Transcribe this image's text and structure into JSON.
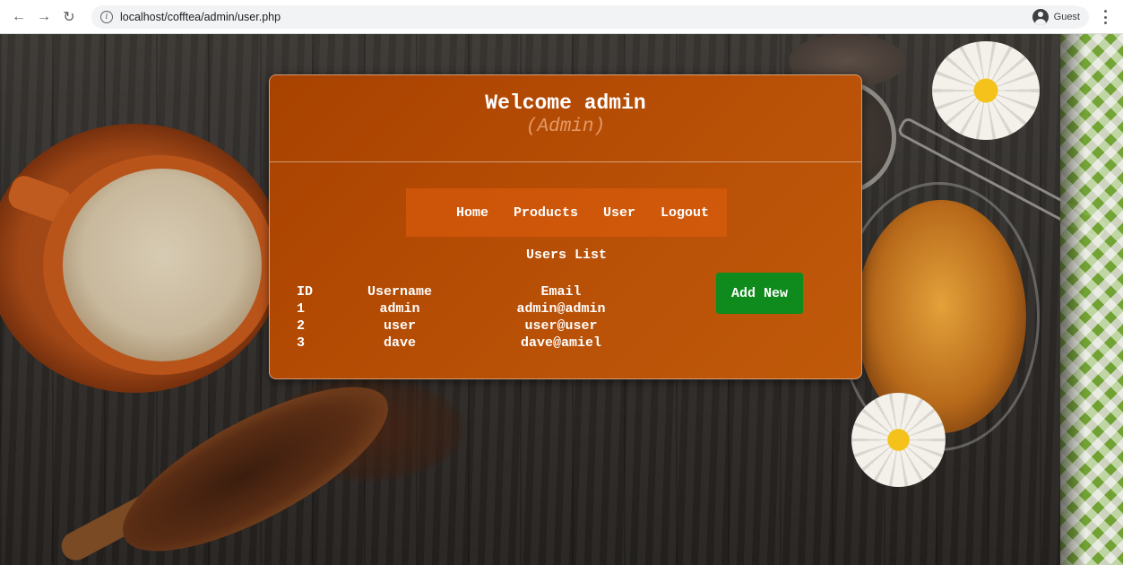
{
  "browser": {
    "url": "localhost/cofftea/admin/user.php",
    "profile_label": "Guest"
  },
  "header": {
    "welcome": "Welcome admin",
    "role": "(Admin)"
  },
  "nav": {
    "items": [
      "Home",
      "Products",
      "User",
      "Logout"
    ]
  },
  "users": {
    "title": "Users List",
    "add_label": "Add New",
    "columns": [
      "ID",
      "Username",
      "Email"
    ],
    "rows": [
      [
        "1",
        "admin",
        "admin@admin"
      ],
      [
        "2",
        "user",
        "user@user"
      ],
      [
        "3",
        "dave",
        "dave@amiel"
      ]
    ]
  },
  "colors": {
    "panel": "#b64d05",
    "add_button": "#0f8a1c",
    "role_text": "#e39a68"
  }
}
